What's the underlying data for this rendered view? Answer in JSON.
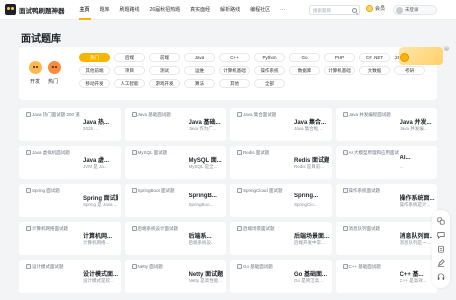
{
  "header": {
    "logo_text": "面试鸭刷题神器",
    "nav": [
      "主页",
      "题库",
      "刷题路线",
      "26届秋招热题",
      "真实面经",
      "解析路线",
      "编程社区"
    ],
    "nav_more": "···",
    "search_placeholder": "搜索题目",
    "vip_label": "会员",
    "login_label": "未登录"
  },
  "page_title": "面试题库",
  "filter": {
    "hot_labels": [
      "开发",
      "热门"
    ],
    "tags": [
      "热门",
      "后端",
      "前端",
      "Java",
      "C++",
      "Python",
      "Go",
      "PHP",
      "C# .NET",
      "26 届秋招热题",
      "其他前端",
      "项目",
      "测试",
      "运维",
      "计算机基础",
      "操作系统",
      "数据库",
      "计算机基础",
      "大数据",
      "考研",
      "移动开发",
      "人工智能",
      "游戏开发",
      "算法",
      "其他",
      "全部"
    ],
    "active_tag_index": 0
  },
  "cards": [
    {
      "img_alt": "Java 热门面试题 200 道",
      "title": "Java 热...",
      "desc": "2025 ..."
    },
    {
      "img_alt": "Java 基础面试题",
      "title": "Java 基础...",
      "desc": "Java 作为广..."
    },
    {
      "img_alt": "Java 集合面试题",
      "title": "Java 集合...",
      "desc": "Java 集合框..."
    },
    {
      "img_alt": "Java 并发编程面试题",
      "title": "Java 并发...",
      "desc": "Java 并发编..."
    },
    {
      "img_alt": "Java 虚拟机面试题",
      "title": "Java 虚...",
      "desc": "JVM 是 Ja..."
    },
    {
      "img_alt": "MySQL 面试题",
      "title": "MySQL 面...",
      "desc": "MySQL 是全..."
    },
    {
      "img_alt": "Redis 面试题",
      "title": "Redis 面试题",
      "desc": "Redis 是目前..."
    },
    {
      "img_alt": "AI 大模型原理和应用面试题",
      "title": "AI...",
      "desc": "..."
    },
    {
      "img_alt": "Spring 面试题",
      "title": "Spring 面试题",
      "desc": "Spring 是 Java ..."
    },
    {
      "img_alt": "SpringBoot 面试题",
      "title": "SpringB...",
      "desc": "SpringBoo..."
    },
    {
      "img_alt": "SpringCloud 面试题",
      "title": "Spring...",
      "desc": "SpringClo..."
    },
    {
      "img_alt": "操作系统面试题",
      "title": "操作系统面...",
      "desc": "操作系统是计..."
    },
    {
      "img_alt": "计算机网络面试题",
      "title": "计算机网...",
      "desc": "计算机网络..."
    },
    {
      "img_alt": "后端系统设计面试题",
      "title": "后端系...",
      "desc": "后端系统设..."
    },
    {
      "img_alt": "后端场景面试题",
      "title": "后端场景面...",
      "desc": "后端开发中常..."
    },
    {
      "img_alt": "消息队列面试题",
      "title": "消息队列面...",
      "desc": "消息队列是一..."
    },
    {
      "img_alt": "设计模式面试题",
      "title": "设计模式面...",
      "desc": "设计模式是软..."
    },
    {
      "img_alt": "Netty 面试题",
      "title": "Netty 面试题",
      "desc": "Netty 是高性能..."
    },
    {
      "img_alt": "Go 基础面试题",
      "title": "Go 基础面...",
      "desc": "Go 是简洁高..."
    },
    {
      "img_alt": "C++ 基础面试题",
      "title": "C++ 基...",
      "desc": "C++ 是高效..."
    }
  ],
  "colors": {
    "accent": "#f7b500",
    "background": "#f3f4f6",
    "card": "#ffffff"
  },
  "sidebar_icons": [
    "translate-icon",
    "chat-icon",
    "clipboard-icon",
    "edit-icon",
    "headset-icon"
  ]
}
